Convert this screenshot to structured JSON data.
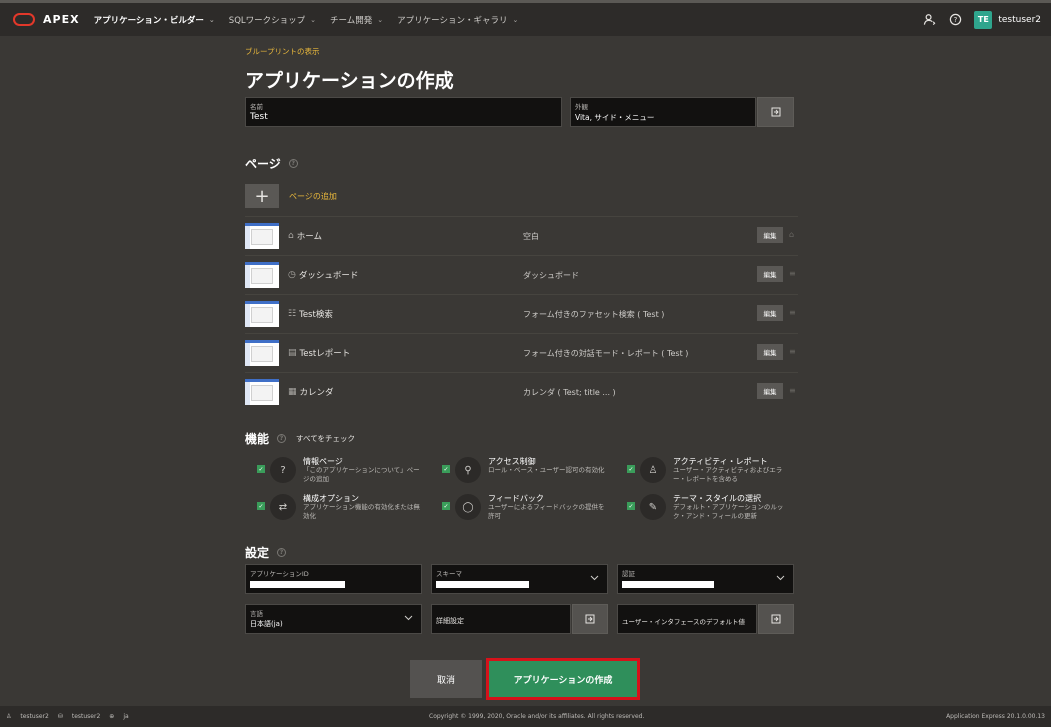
{
  "topbar": {
    "brand": "APEX",
    "nav": [
      {
        "label": "アプリケーション・ビルダー",
        "active": true
      },
      {
        "label": "SQLワークショップ",
        "active": false
      },
      {
        "label": "チーム開発",
        "active": false
      },
      {
        "label": "アプリケーション・ギャラリ",
        "active": false
      }
    ],
    "avatar_initials": "TE",
    "username": "testuser2"
  },
  "header": {
    "blueprint_link": "ブループリントの表示",
    "title": "アプリケーションの作成"
  },
  "app_fields": {
    "name_label": "名前",
    "name_value": "Test",
    "appearance_label": "外観",
    "appearance_value": "Vita, サイド・メニュー"
  },
  "pages_section": {
    "title": "ページ",
    "add_label": "ページの追加",
    "edit_label": "編集",
    "rows": [
      {
        "icon": "⌂",
        "name": "ホーム",
        "type": "空白"
      },
      {
        "icon": "◷",
        "name": "ダッシュボード",
        "type": "ダッシュボード"
      },
      {
        "icon": "☷",
        "name": "Test検索",
        "type": "フォーム付きのファセット検索 ( Test )"
      },
      {
        "icon": "▤",
        "name": "Testレポート",
        "type": "フォーム付きの対話モード・レポート ( Test )"
      },
      {
        "icon": "▦",
        "name": "カレンダ",
        "type": "カレンダ ( Test; title ... )"
      }
    ]
  },
  "features_section": {
    "title": "機能",
    "check_all": "すべてをチェック",
    "items": [
      {
        "icon": "?",
        "title": "情報ページ",
        "desc": "「このアプリケーションについて」ページの追加"
      },
      {
        "icon": "⚲",
        "title": "アクセス制御",
        "desc": "ロール・ベース・ユーザー認可の有効化"
      },
      {
        "icon": "♙",
        "title": "アクティビティ・レポート",
        "desc": "ユーザー・アクティビティおよびエラー・レポートを含める"
      },
      {
        "icon": "⇄",
        "title": "構成オプション",
        "desc": "アプリケーション機能の有効化または無効化"
      },
      {
        "icon": "◯",
        "title": "フィードバック",
        "desc": "ユーザーによるフィードバックの提供を許可"
      },
      {
        "icon": "✎",
        "title": "テーマ・スタイルの選択",
        "desc": "デフォルト・アプリケーションのルック・アンド・フィールの更新"
      }
    ]
  },
  "settings_section": {
    "title": "設定",
    "app_id_label": "アプリケーションID",
    "app_id_value": "",
    "schema_label": "スキーマ",
    "schema_value": "",
    "auth_label": "認証",
    "auth_value": "",
    "language_label": "言語",
    "language_value": "日本語(ja)",
    "advanced_label": "詳細設定",
    "ui_defaults_label": "ユーザー・インタフェースのデフォルト値"
  },
  "actions": {
    "cancel": "取消",
    "create": "アプリケーションの作成"
  },
  "footer": {
    "user": "testuser2",
    "schema": "testuser2",
    "lang": "ja",
    "copyright": "Copyright © 1999, 2020, Oracle and/or its affiliates. All rights reserved.",
    "version": "Application Express 20.1.0.00.13"
  },
  "colors": {
    "accent_yellow": "#e9b83c",
    "create_green": "#2f8f5b",
    "highlight_red": "#d6121a",
    "avatar_teal": "#2fa58d",
    "oracle_red": "#e2382a"
  }
}
